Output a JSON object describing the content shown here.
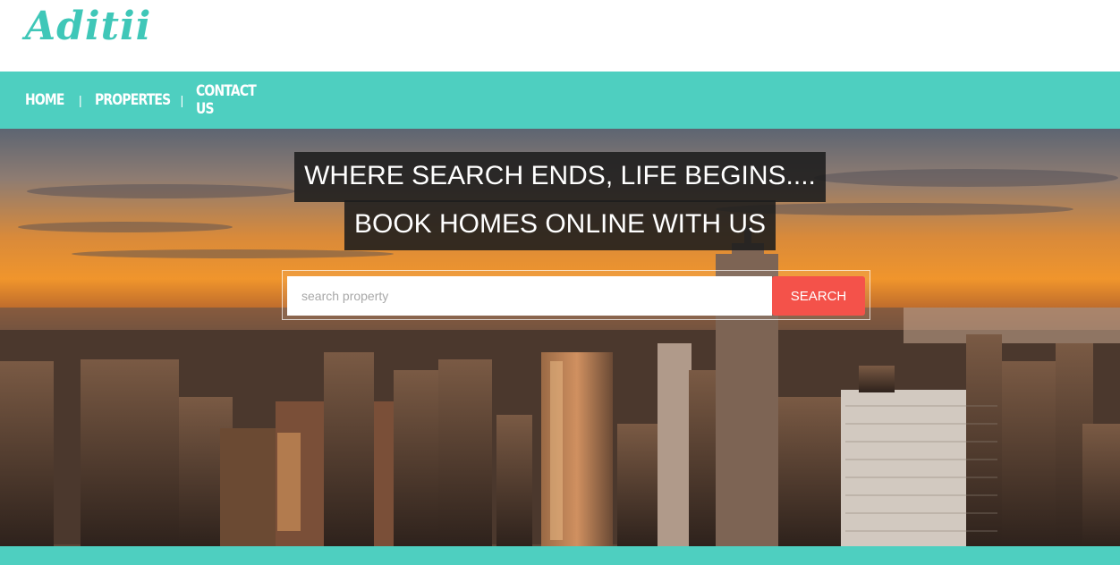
{
  "header": {
    "logo_text": "Aditii"
  },
  "nav": {
    "items": [
      {
        "label": "HOME"
      },
      {
        "label": "PROPERTES"
      },
      {
        "label": "CONTACT US"
      }
    ],
    "separator": "|"
  },
  "hero": {
    "headline_line1": "WHERE SEARCH ENDS, LIFE BEGINS....",
    "headline_line2": "BOOK HOMES ONLINE WITH US",
    "background": "city skyline at sunset"
  },
  "search": {
    "placeholder": "search property",
    "value": "",
    "button_label": "SEARCH"
  },
  "colors": {
    "brand": "#4ecfc0",
    "logo": "#3fc7b8",
    "search_button": "#f4524a"
  }
}
